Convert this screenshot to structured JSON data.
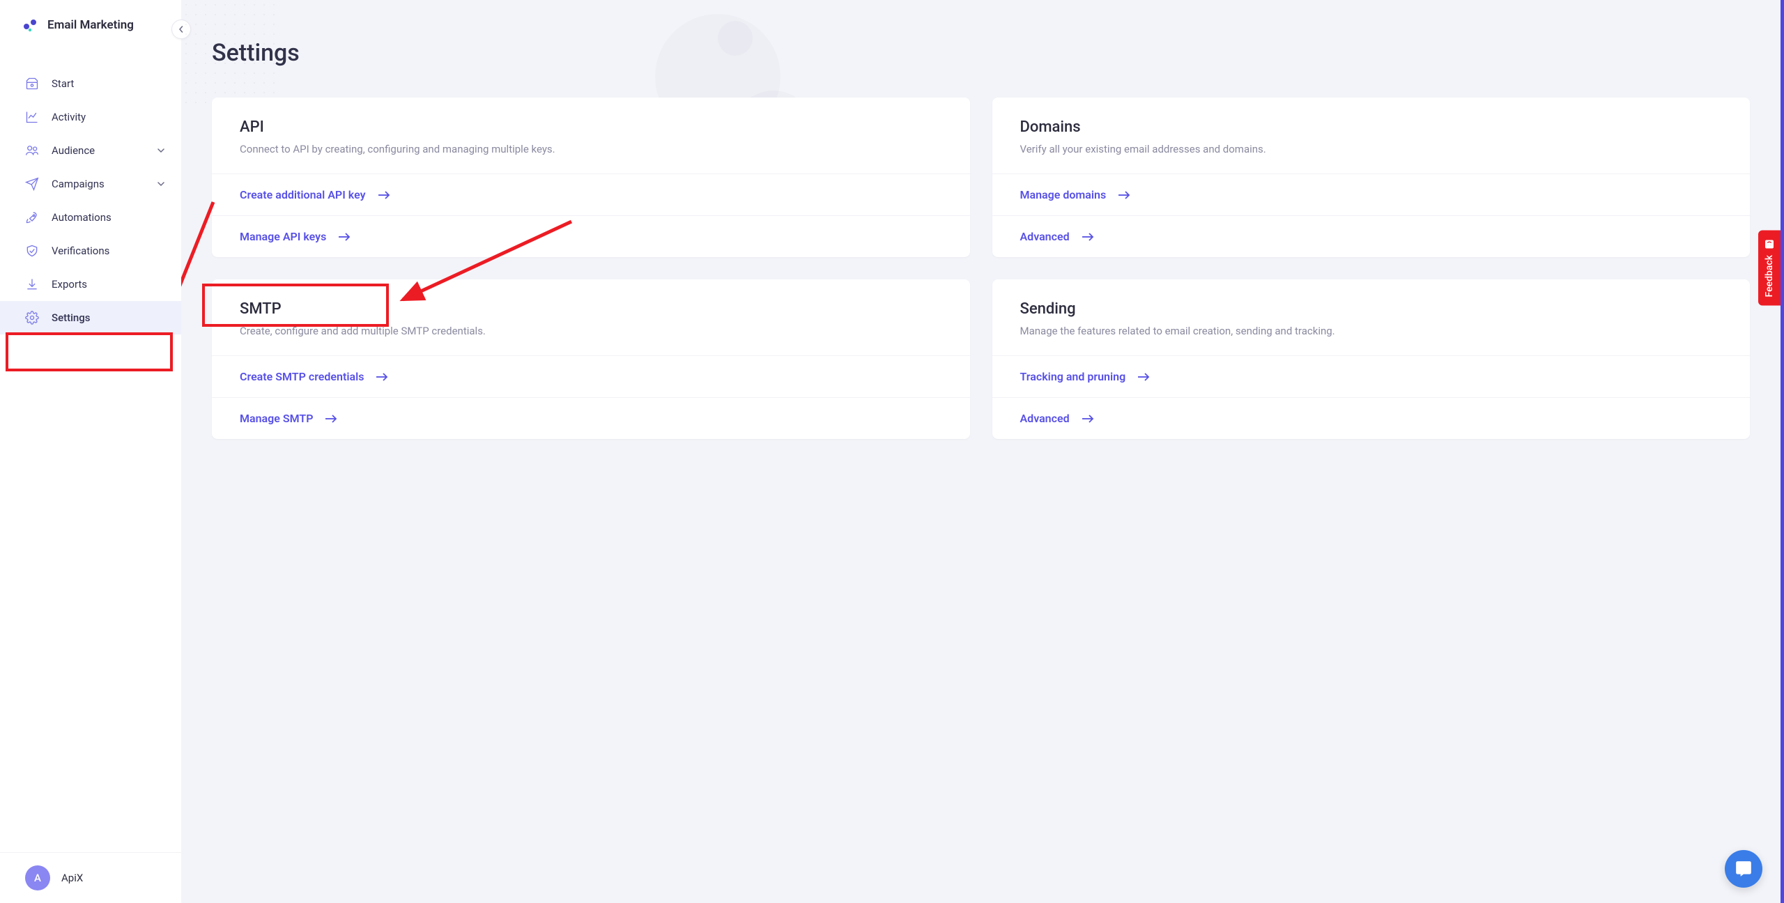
{
  "app_name": "Email Marketing",
  "sidebar": {
    "items": [
      {
        "label": "Start"
      },
      {
        "label": "Activity"
      },
      {
        "label": "Audience",
        "expandable": true
      },
      {
        "label": "Campaigns",
        "expandable": true
      },
      {
        "label": "Automations"
      },
      {
        "label": "Verifications"
      },
      {
        "label": "Exports"
      },
      {
        "label": "Settings",
        "active": true
      }
    ]
  },
  "user": {
    "initial": "A",
    "name": "ApiX"
  },
  "page": {
    "title": "Settings"
  },
  "cards": {
    "api": {
      "title": "API",
      "desc": "Connect to API by creating, configuring and managing multiple keys.",
      "link1": "Create additional API key",
      "link2": "Manage API keys"
    },
    "domains": {
      "title": "Domains",
      "desc": "Verify all your existing email addresses and domains.",
      "link1": "Manage domains",
      "link2": "Advanced"
    },
    "smtp": {
      "title": "SMTP",
      "desc": "Create, configure and add multiple SMTP credentials.",
      "link1": "Create SMTP credentials",
      "link2": "Manage SMTP"
    },
    "sending": {
      "title": "Sending",
      "desc": "Manage the features related to email creation, sending and tracking.",
      "link1": "Tracking and pruning",
      "link2": "Advanced"
    }
  },
  "feedback_label": "Feedback"
}
